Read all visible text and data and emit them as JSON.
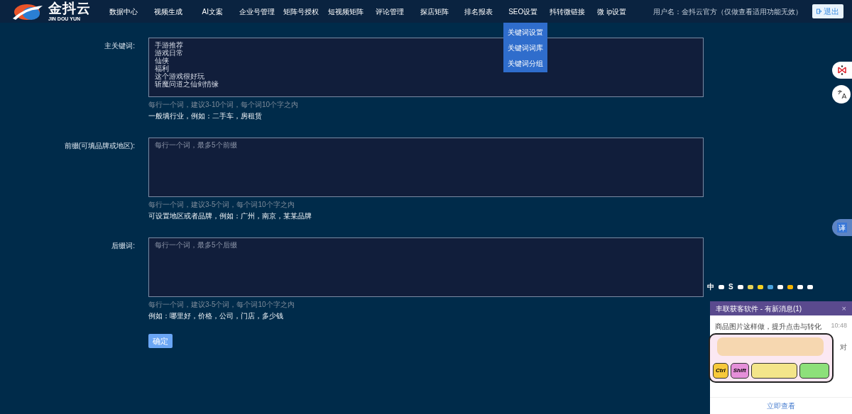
{
  "logo": {
    "name": "金抖云",
    "subtitle": "JIN DOU YUN"
  },
  "nav": [
    {
      "label": "数据中心"
    },
    {
      "label": "视频生成"
    },
    {
      "label": "AI文案"
    },
    {
      "label": "企业号管理"
    },
    {
      "label": "矩阵号授权"
    },
    {
      "label": "短视频矩阵"
    },
    {
      "label": "评论管理"
    },
    {
      "label": "探店矩阵"
    },
    {
      "label": "排名报表"
    },
    {
      "label": "SEO设置",
      "menu": [
        "关键词设置",
        "关键词词库",
        "关键词分组"
      ]
    },
    {
      "label": "抖转微链接"
    },
    {
      "label": "微 ip设置"
    }
  ],
  "user": "用户名：金抖云官方（仅做查看适用功能无效）",
  "logout": "退出",
  "fields": [
    {
      "label": "主关键词:",
      "lines": [
        "手游推荐",
        "游戏日常",
        "仙侠",
        "福利",
        "这个游戏很好玩",
        "斩魔问道之仙剑情缘"
      ],
      "hint": "每行一个词，建议3-10个词，每个词10个字之内",
      "example": "一般填行业，例如：二手车，房租赁"
    },
    {
      "label": "前缀(可填品牌或地区):",
      "placeholder": "每行一个词，最多5个前缀",
      "hint": "每行一个词，建议3-5个词，每个词10个字之内",
      "example": "可设置地区或者品牌，例如：广州，南京，某某品牌"
    },
    {
      "label": "后缀词:",
      "placeholder": "每行一个词，最多5个后缀",
      "hint": "每行一个词，建议3-5个词，每个词10个字之内",
      "example": "例如：哪里好，价格，公司，门店，多少钱"
    }
  ],
  "submit": "确定",
  "side_translate": "译",
  "tray": [
    {
      "kind": "glyph",
      "text": "中"
    },
    {
      "kind": "icon"
    },
    {
      "kind": "glyph",
      "text": "S"
    },
    {
      "kind": "icon"
    },
    {
      "kind": "icon"
    },
    {
      "kind": "icon"
    },
    {
      "kind": "icon"
    },
    {
      "kind": "icon"
    },
    {
      "kind": "icon"
    },
    {
      "kind": "icon"
    },
    {
      "kind": "icon"
    }
  ],
  "popup": {
    "title": "丰联获客软件 - 有新消息(1)",
    "close": "×",
    "message": "商品图片这样做，提升点击与转化",
    "time": "10:48",
    "snippet": "对",
    "action": "立即查看"
  },
  "sticker": {
    "keys": [
      "Ctrl",
      "Shift"
    ]
  }
}
